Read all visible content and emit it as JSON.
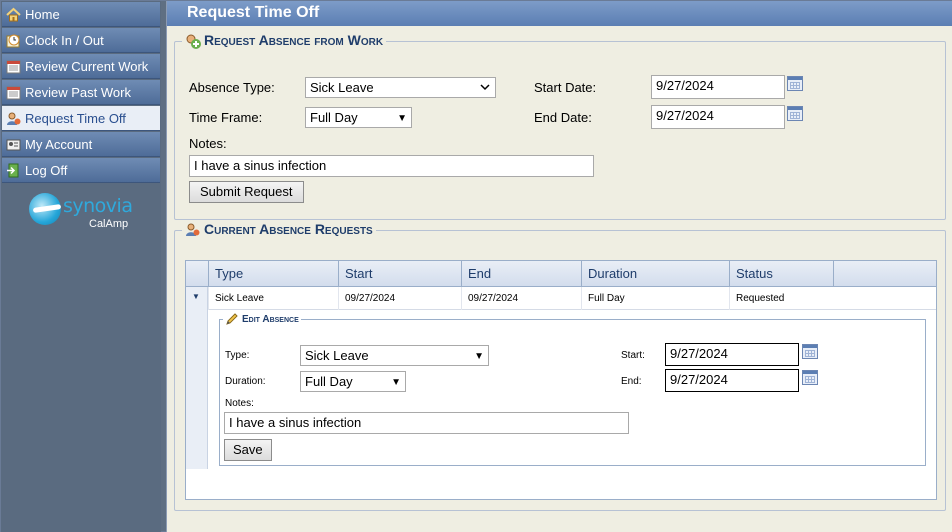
{
  "sidebar": {
    "items": [
      {
        "label": "Home",
        "icon": "home-icon"
      },
      {
        "label": "Clock In / Out",
        "icon": "clock-icon"
      },
      {
        "label": "Review Current Work",
        "icon": "calendar-icon"
      },
      {
        "label": "Review Past Work",
        "icon": "calendar-icon"
      },
      {
        "label": "Request Time Off",
        "icon": "person-icon",
        "active": true
      },
      {
        "label": "My Account",
        "icon": "id-card-icon"
      },
      {
        "label": "Log Off",
        "icon": "exit-icon"
      }
    ],
    "logo": {
      "name": "synovia",
      "sub": "CalAmp"
    }
  },
  "header": {
    "title": "Request Time Off"
  },
  "request_form": {
    "legend": "Request Absence from Work",
    "absence_type_label": "Absence Type:",
    "absence_type_value": "Sick Leave",
    "time_frame_label": "Time Frame:",
    "time_frame_value": "Full Day",
    "start_date_label": "Start Date:",
    "start_date_value": "9/27/2024",
    "end_date_label": "End Date:",
    "end_date_value": "9/27/2024",
    "notes_label": "Notes:",
    "notes_value": "I have a sinus infection",
    "submit_label": "Submit Request"
  },
  "requests": {
    "legend": "Current Absence Requests",
    "columns": [
      "Type",
      "Start",
      "End",
      "Duration",
      "Status"
    ],
    "rows": [
      {
        "type": "Sick Leave",
        "start": "09/27/2024",
        "end": "09/27/2024",
        "duration": "Full Day",
        "status": "Requested"
      }
    ],
    "edit": {
      "legend": "Edit Absence",
      "type_label": "Type:",
      "type_value": "Sick Leave",
      "duration_label": "Duration:",
      "duration_value": "Full Day",
      "start_label": "Start:",
      "start_value": "9/27/2024",
      "end_label": "End:",
      "end_value": "9/27/2024",
      "notes_label": "Notes:",
      "notes_value": "I have a sinus infection",
      "save_label": "Save"
    }
  },
  "colors": {
    "accent": "#5b7eb3",
    "panel": "#efeee2",
    "sidebar": "#5a6b80"
  }
}
